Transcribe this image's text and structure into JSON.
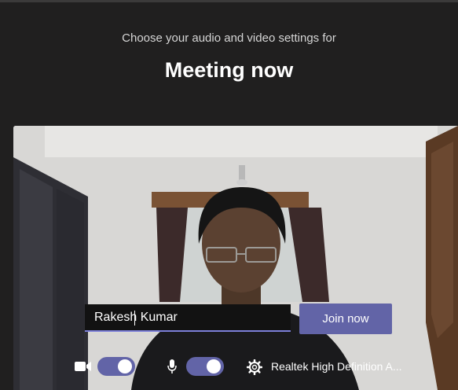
{
  "header": {
    "subtitle": "Choose your audio and video settings for",
    "title": "Meeting now"
  },
  "join_form": {
    "name_value": "Rakesh Kumar",
    "join_label": "Join now"
  },
  "devices": {
    "camera_icon": "video-camera-icon",
    "camera_enabled": true,
    "mic_icon": "microphone-icon",
    "mic_enabled": true,
    "settings_icon": "gear-icon",
    "audio_device_label": "Realtek High Definition A..."
  },
  "colors": {
    "background": "#201f1f",
    "accent": "#6264a7",
    "input_underline": "#7c7fd9"
  }
}
